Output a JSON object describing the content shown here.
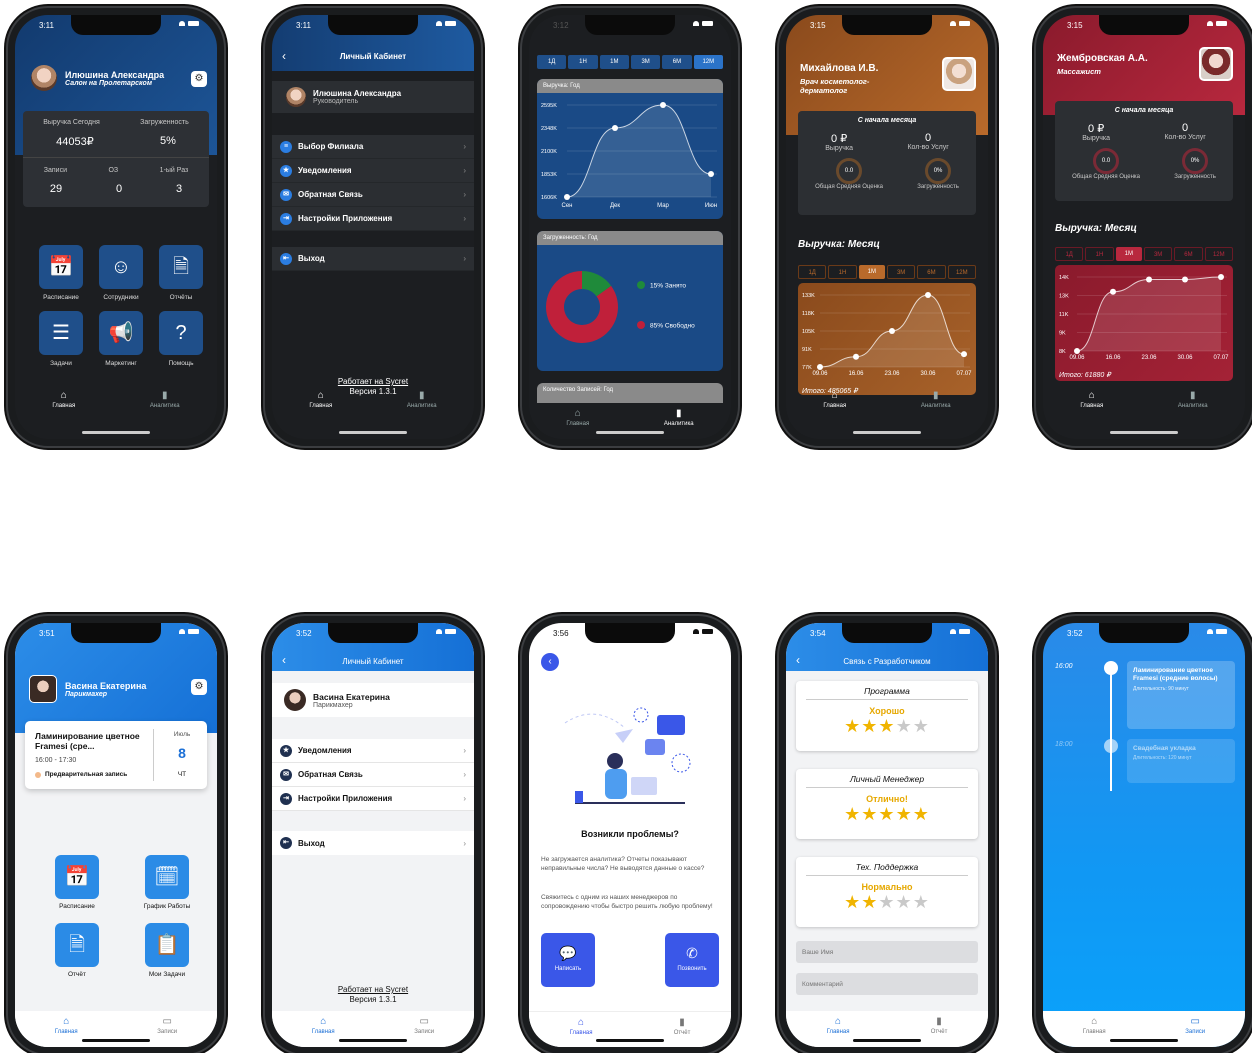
{
  "p1": {
    "time": "3:11",
    "name": "Илюшина Александра",
    "salon": "Салон на Пролетарском",
    "stats": {
      "rev_label": "Выручка Сегодня",
      "load_label": "Загруженность",
      "rev": "44053₽",
      "load": "5%",
      "rec_label": "Записи",
      "oz_label": "ОЗ",
      "first_label": "1-ый Раз",
      "rec": "29",
      "oz": "0",
      "first": "3"
    },
    "tiles": [
      "Расписание",
      "Сотрудники",
      "Отчёты",
      "Задачи",
      "Маркетинг",
      "Помощь"
    ],
    "tabs": [
      "Главная",
      "Аналитика"
    ]
  },
  "p2": {
    "time": "3:11",
    "title": "Личный Кабинет",
    "name": "Илюшина Александра",
    "role": "Руководитель",
    "menu": [
      "Выбор Филиала",
      "Уведомления",
      "Обратная Связь",
      "Настройки Приложения"
    ],
    "exit": "Выход",
    "powered": "Работает на Sycret",
    "version": "Версия 1.3.1",
    "tabs": [
      "Главная",
      "Аналитика"
    ]
  },
  "p3": {
    "time": "3:12",
    "periods": [
      "1Д",
      "1Н",
      "1М",
      "3М",
      "6М",
      "12М"
    ],
    "rev_title": "Выручка: Год",
    "load_title": "Загруженность: Год",
    "rec_title": "Количество Записей: Год",
    "busy": "15% Занято",
    "free": "85% Свободно",
    "tabs": [
      "Главная",
      "Аналитика"
    ]
  },
  "p4": {
    "time": "3:15",
    "name": "Михайлова И.В.",
    "role": "Врач косметолог-дерматолог",
    "since": "С начала месяца",
    "rev": "0 ₽",
    "rev_label": "Выручка",
    "cnt": "0",
    "cnt_label": "Кол-во Услуг",
    "rating": "0.0",
    "rating_label": "Общая Средняя Оценка",
    "load": "0%",
    "load_label": "Загруженность",
    "chart_title": "Выручка: Месяц",
    "periods": [
      "1Д",
      "1Н",
      "1М",
      "3М",
      "6М",
      "12М"
    ],
    "total": "Итого: 485065 ₽",
    "tabs": [
      "Главная",
      "Аналитика"
    ]
  },
  "p5": {
    "time": "3:15",
    "name": "Жембровская А.А.",
    "role": "Массажист",
    "since": "С начала месяца",
    "rev": "0 ₽",
    "rev_label": "Выручка",
    "cnt": "0",
    "cnt_label": "Кол-во Услуг",
    "rating": "0.0",
    "rating_label": "Общая Средняя Оценка",
    "load": "0%",
    "load_label": "Загруженность",
    "chart_title": "Выручка: Месяц",
    "periods": [
      "1Д",
      "1Н",
      "1М",
      "3М",
      "6М",
      "12М"
    ],
    "total": "Итого: 61880 ₽",
    "tabs": [
      "Главная",
      "Аналитика"
    ]
  },
  "p6": {
    "time": "3:51",
    "name": "Васина Екатерина",
    "role": "Парикмахер",
    "appt": "Ламинирование цветное Framesi (сре...",
    "appt_time": "16:00 - 17:30",
    "appt_status": "Предварительная запись",
    "month": "Июль",
    "day": "8",
    "dow": "ЧТ",
    "tiles": [
      "Расписание",
      "График Работы",
      "Отчёт",
      "Мои Задачи"
    ],
    "tabs": [
      "Главная",
      "Записи"
    ]
  },
  "p7": {
    "time": "3:52",
    "title": "Личный Кабинет",
    "name": "Васина Екатерина",
    "role": "Парикмахер",
    "menu": [
      "Уведомления",
      "Обратная Связь",
      "Настройки Приложения"
    ],
    "exit": "Выход",
    "powered": "Работает на Sycret",
    "version": "Версия 1.3.1",
    "tabs": [
      "Главная",
      "Записи"
    ]
  },
  "p8": {
    "time": "3:56",
    "heading": "Возникли проблемы?",
    "text1": "Не загружается аналитика? Отчеты показывают неправильные числа? Не выводятся данные о кассе?",
    "text2": "Свяжитесь с одним из наших менеджеров по сопровождению чтобы быстро решить любую проблему!",
    "write": "Написать",
    "call": "Позвонить",
    "tabs": [
      "Главная",
      "Отчёт"
    ]
  },
  "p9": {
    "time": "3:54",
    "title": "Связь с Разработчиком",
    "cards": [
      {
        "title": "Программа",
        "grade": "Хорошо",
        "stars": 3
      },
      {
        "title": "Личный Менеджер",
        "grade": "Отлично!",
        "stars": 5
      },
      {
        "title": "Тех. Поддержка",
        "grade": "Нормально",
        "stars": 2
      }
    ],
    "name_ph": "Ваше Имя",
    "comment_ph": "Комментарий",
    "tabs": [
      "Главная",
      "Отчёт"
    ]
  },
  "p10": {
    "time": "3:52",
    "t1": "16:00",
    "e1": "Ламинирование цветное Framesi (средние волосы)",
    "d1": "Длительность: 90 минут",
    "t2": "18:00",
    "e2": "Свадебная укладка",
    "d2": "Длительность: 120 минут",
    "tabs": [
      "Главная",
      "Записи"
    ]
  },
  "chart_data": [
    {
      "type": "line",
      "title": "Выручка: Год",
      "categories": [
        "Сен",
        "Дек",
        "Мар",
        "Июн"
      ],
      "y_ticks": [
        "1606K",
        "1853K",
        "2100K",
        "2348K",
        "2595K"
      ],
      "values": [
        1606,
        2348,
        2595,
        1853
      ]
    },
    {
      "type": "pie",
      "title": "Загруженность: Год",
      "categories": [
        "15% Занято",
        "85% Свободно"
      ],
      "values": [
        15,
        85
      ],
      "colors": [
        "#1f8a3a",
        "#c0203a"
      ]
    },
    {
      "type": "line",
      "title": "Выручка: Месяц",
      "categories": [
        "09.06",
        "16.06",
        "23.06",
        "30.06",
        "07.07"
      ],
      "y_ticks": [
        "77K",
        "91K",
        "105K",
        "118K",
        "133K"
      ],
      "values": [
        77,
        85,
        105,
        133,
        87
      ],
      "ylim": [
        77,
        133
      ]
    },
    {
      "type": "line",
      "title": "Выручка: Месяц",
      "categories": [
        "09.06",
        "16.06",
        "23.06",
        "30.06",
        "07.07"
      ],
      "y_ticks": [
        "8K",
        "9K",
        "11K",
        "13K",
        "14K"
      ],
      "values": [
        8,
        12.8,
        13.8,
        13.8,
        14
      ],
      "ylim": [
        8,
        14
      ]
    }
  ]
}
